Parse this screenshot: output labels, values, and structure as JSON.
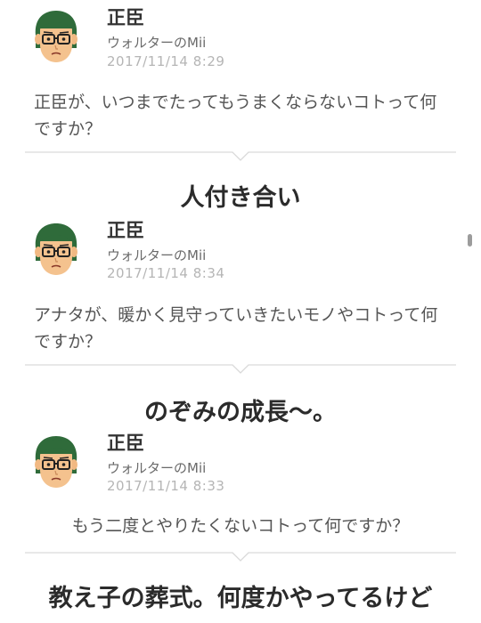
{
  "posts": [
    {
      "name": "正臣",
      "owner": "ウォルターのMii",
      "timestamp": "2017/11/14  8:29",
      "question": "正臣が、いつまでたってもうまくならないコトって何ですか？",
      "answer": "人付き合い"
    },
    {
      "name": "正臣",
      "owner": "ウォルターのMii",
      "timestamp": "2017/11/14  8:34",
      "question": "アナタが、暖かく見守っていきたいモノやコトって何ですか？",
      "answer": "のぞみの成長〜。"
    },
    {
      "name": "正臣",
      "owner": "ウォルターのMii",
      "timestamp": "2017/11/14  8:33",
      "question": "もう二度とやりたくないコトって何ですか？",
      "answer": "教え子の葬式。何度かやってるけど"
    }
  ],
  "colors": {
    "hair": "#2f6b3a",
    "skin": "#f4c28e",
    "divider": "#d9d9d9"
  },
  "icons": {
    "avatar": "mii-avatar-icon",
    "divider": "chevron-divider"
  }
}
